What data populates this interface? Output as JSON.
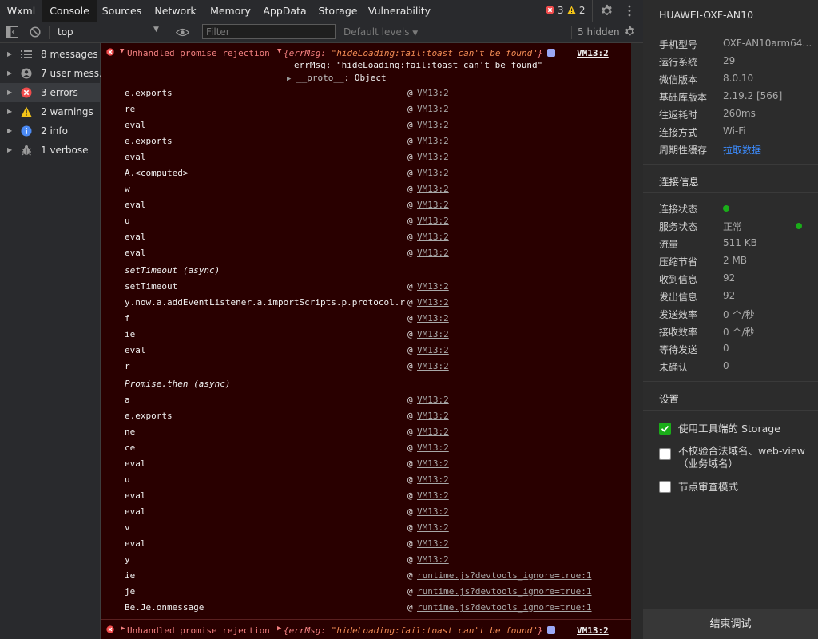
{
  "tabs": [
    {
      "label": "Wxml",
      "active": false
    },
    {
      "label": "Console",
      "active": true
    },
    {
      "label": "Sources",
      "active": false
    },
    {
      "label": "Network",
      "active": false
    },
    {
      "label": "Memory",
      "active": false
    },
    {
      "label": "AppData",
      "active": false
    },
    {
      "label": "Storage",
      "active": false
    },
    {
      "label": "Vulnerability",
      "active": false
    }
  ],
  "badges": {
    "errors": "3",
    "warnings": "2"
  },
  "toolbar": {
    "context": "top",
    "filter_placeholder": "Filter",
    "levels": "Default levels",
    "hidden": "5 hidden"
  },
  "sidebar": {
    "items": [
      {
        "label": "8 messages",
        "icon": "list-icon",
        "selected": false
      },
      {
        "label": "7 user mess…",
        "icon": "user-icon",
        "selected": false
      },
      {
        "label": "3 errors",
        "icon": "error-icon",
        "selected": true
      },
      {
        "label": "2 warnings",
        "icon": "warning-icon",
        "selected": false
      },
      {
        "label": "2 info",
        "icon": "info-icon",
        "selected": false
      },
      {
        "label": "1 verbose",
        "icon": "bug-icon",
        "selected": false
      }
    ]
  },
  "console": {
    "error_title": "Unhandled promise rejection",
    "error_obj_prefix": "{errMsg: ",
    "error_obj_value": "\"hideLoading:fail:toast can't be found\"",
    "error_obj_suffix": "}",
    "error_source": "VM13:2",
    "errmsg_key": "errMsg: ",
    "errmsg_value": "\"hideLoading:fail:toast can't be found\"",
    "proto_key": "__proto__",
    "proto_value": ": Object",
    "at": "@",
    "stack": [
      {
        "fn": "e.exports",
        "src": "VM13:2"
      },
      {
        "fn": "re",
        "src": "VM13:2"
      },
      {
        "fn": "eval",
        "src": "VM13:2"
      },
      {
        "fn": "e.exports",
        "src": "VM13:2"
      },
      {
        "fn": "eval",
        "src": "VM13:2"
      },
      {
        "fn": "A.<computed>",
        "src": "VM13:2"
      },
      {
        "fn": "w",
        "src": "VM13:2"
      },
      {
        "fn": "eval",
        "src": "VM13:2"
      },
      {
        "fn": "u",
        "src": "VM13:2"
      },
      {
        "fn": "eval",
        "src": "VM13:2"
      },
      {
        "fn": "eval",
        "src": "VM13:2"
      },
      {
        "async": "setTimeout (async)"
      },
      {
        "fn": "setTimeout",
        "src": "VM13:2"
      },
      {
        "fn": "y.now.a.addEventListener.a.importScripts.p.protocol.r",
        "src": "VM13:2"
      },
      {
        "fn": "f",
        "src": "VM13:2"
      },
      {
        "fn": "ie",
        "src": "VM13:2"
      },
      {
        "fn": "eval",
        "src": "VM13:2"
      },
      {
        "fn": "r",
        "src": "VM13:2"
      },
      {
        "async": "Promise.then (async)"
      },
      {
        "fn": "a",
        "src": "VM13:2"
      },
      {
        "fn": "e.exports",
        "src": "VM13:2"
      },
      {
        "fn": "ne",
        "src": "VM13:2"
      },
      {
        "fn": "ce",
        "src": "VM13:2"
      },
      {
        "fn": "eval",
        "src": "VM13:2"
      },
      {
        "fn": "u",
        "src": "VM13:2"
      },
      {
        "fn": "eval",
        "src": "VM13:2"
      },
      {
        "fn": "eval",
        "src": "VM13:2"
      },
      {
        "fn": "v",
        "src": "VM13:2"
      },
      {
        "fn": "eval",
        "src": "VM13:2"
      },
      {
        "fn": "y",
        "src": "VM13:2"
      },
      {
        "fn": "ie",
        "src": "runtime.js?devtools_ignore=true:1"
      },
      {
        "fn": "je",
        "src": "runtime.js?devtools_ignore=true:1"
      },
      {
        "fn": "Be.Je.onmessage",
        "src": "runtime.js?devtools_ignore=true:1"
      }
    ]
  },
  "panel": {
    "device": "HUAWEI-OXF-AN10",
    "info": [
      {
        "k": "手机型号",
        "v": "OXF-AN10arm64…"
      },
      {
        "k": "运行系统",
        "v": "29"
      },
      {
        "k": "微信版本",
        "v": "8.0.10"
      },
      {
        "k": "基础库版本",
        "v": "2.19.2 [566]"
      },
      {
        "k": "往返耗时",
        "v": "260ms"
      },
      {
        "k": "连接方式",
        "v": "Wi-Fi"
      },
      {
        "k": "周期性缓存",
        "v": "拉取数据"
      }
    ],
    "conn_title": "连接信息",
    "conn": [
      {
        "k": "连接状态",
        "v": ""
      },
      {
        "k": "服务状态",
        "v": "正常"
      },
      {
        "k": "流量",
        "v": "511 KB"
      },
      {
        "k": "压缩节省",
        "v": "2 MB"
      },
      {
        "k": "收到信息",
        "v": "92"
      },
      {
        "k": "发出信息",
        "v": "92"
      },
      {
        "k": "发送效率",
        "v": "0 个/秒"
      },
      {
        "k": "接收效率",
        "v": "0 个/秒"
      },
      {
        "k": "等待发送",
        "v": "0"
      },
      {
        "k": "未确认",
        "v": "0"
      }
    ],
    "settings_title": "设置",
    "settings": [
      {
        "label": "使用工具端的 Storage",
        "checked": true
      },
      {
        "label": "不校验合法域名、web-view（业务域名）",
        "checked": false
      },
      {
        "label": "节点审查模式",
        "checked": false
      }
    ],
    "end_button": "结束调试"
  },
  "colors": {
    "error": "#f24c4c",
    "warning": "#f5c518",
    "info": "#4c8bf5",
    "ok": "#1aad19",
    "link": "#3c8cff"
  }
}
